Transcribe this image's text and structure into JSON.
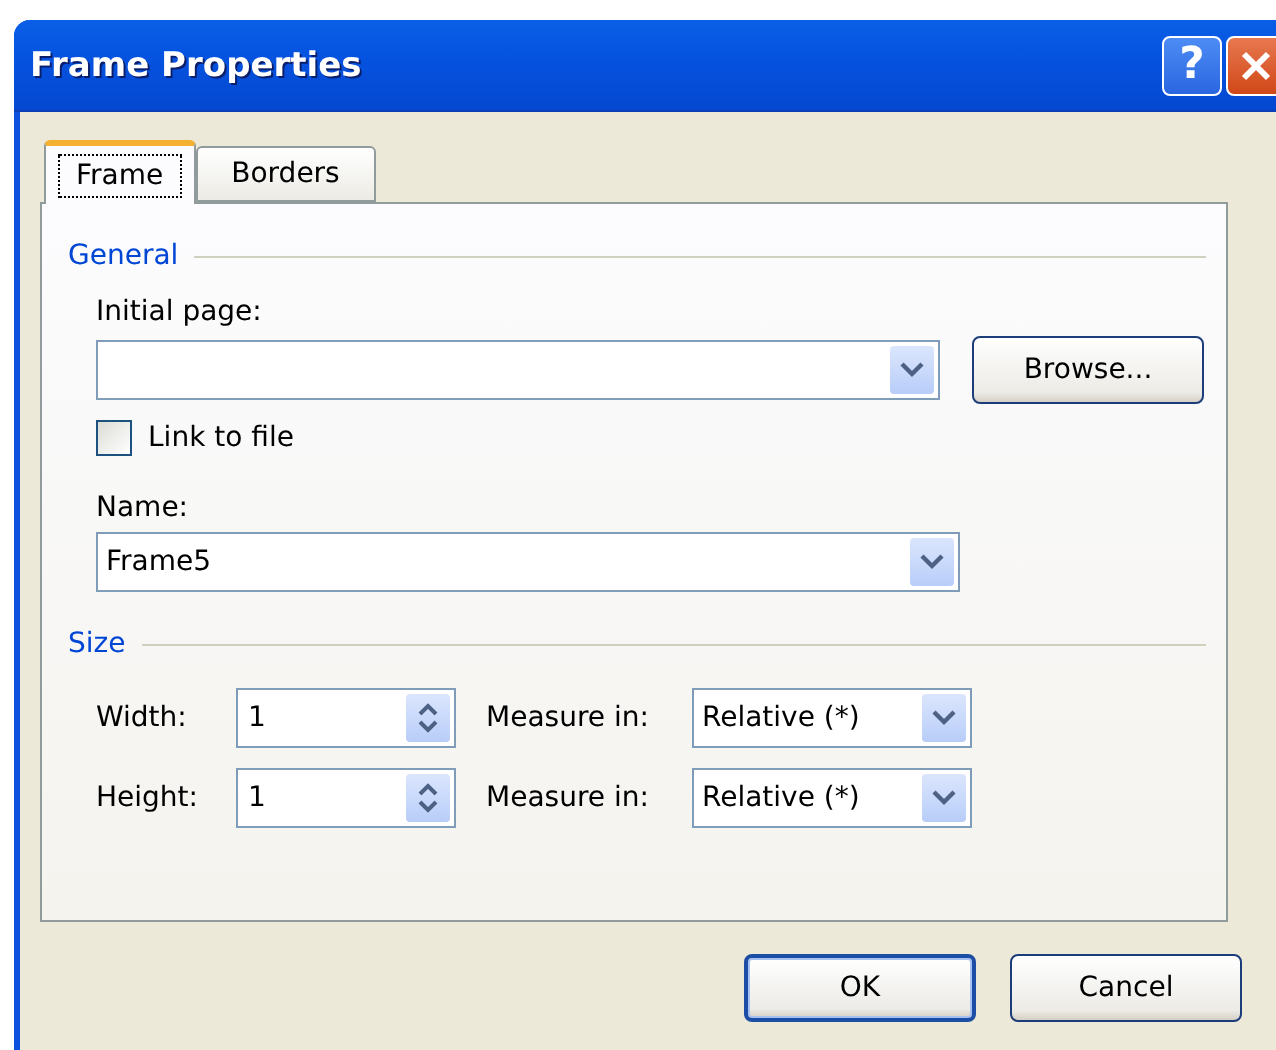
{
  "window": {
    "title": "Frame Properties",
    "help_button": "?"
  },
  "tabs": [
    {
      "label": "Frame",
      "selected": true
    },
    {
      "label": "Borders",
      "selected": false
    }
  ],
  "general": {
    "heading": "General",
    "initial_page": {
      "label": "Initial page:"
    },
    "browse_button": "Browse...",
    "link_to_file": {
      "label": "Link to file",
      "checked": false
    },
    "name": {
      "label": "Name:",
      "value": "Frame5"
    }
  },
  "size": {
    "heading": "Size",
    "rows": [
      {
        "label": "Width:",
        "value": "1",
        "measure_label": "Measure in:",
        "measure_value": "Relative (*)"
      },
      {
        "label": "Height:",
        "value": "1",
        "measure_label": "Measure in:",
        "measure_value": "Relative (*)"
      }
    ]
  },
  "buttons": [
    {
      "label": "OK",
      "default": true
    },
    {
      "label": "Cancel",
      "default": false
    }
  ]
}
